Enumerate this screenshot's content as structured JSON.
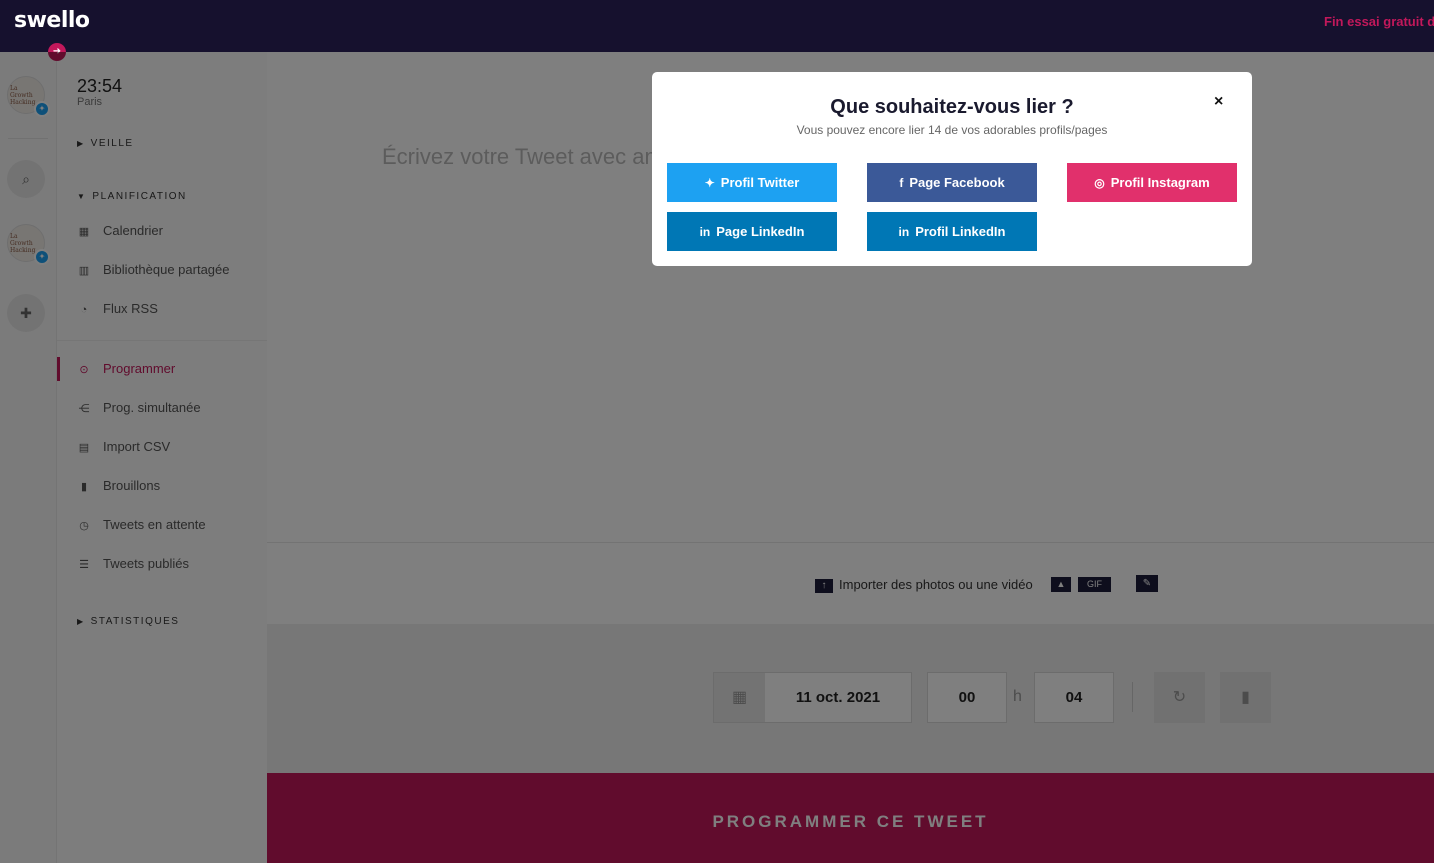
{
  "topbar": {
    "logo": "swello",
    "trial_text": "Fin essai gratuit da"
  },
  "sidebar": {
    "time": "23:54",
    "city": "Paris",
    "sections": {
      "veille": "VEILLE",
      "planification": "PLANIFICATION",
      "statistiques": "STATISTIQUES"
    },
    "items": [
      {
        "label": "Calendrier",
        "icon": "calendar-icon"
      },
      {
        "label": "Bibliothèque partagée",
        "icon": "library-icon"
      },
      {
        "label": "Flux RSS",
        "icon": "rss-icon"
      },
      {
        "label": "Programmer",
        "icon": "clock-icon",
        "active": true
      },
      {
        "label": "Prog. simultanée",
        "icon": "share-icon"
      },
      {
        "label": "Import CSV",
        "icon": "table-icon"
      },
      {
        "label": "Brouillons",
        "icon": "draft-icon"
      },
      {
        "label": "Tweets en attente",
        "icon": "history-icon"
      },
      {
        "label": "Tweets publiés",
        "icon": "list-icon"
      }
    ]
  },
  "rail": {
    "avatar_text": "La Growth Hacking"
  },
  "editor": {
    "placeholder": "Écrivez votre Tweet avec amour"
  },
  "media": {
    "upload_label": "Importer des photos ou une vidéo",
    "gif_label": "GIF"
  },
  "schedule": {
    "date": "11 oct. 2021",
    "hour": "00",
    "hour_sep": "h",
    "minute": "04"
  },
  "submit_label": "PROGRAMMER CE TWEET",
  "modal": {
    "title": "Que souhaitez-vous lier ?",
    "subtitle": "Vous pouvez encore lier 14 de vos adorables profils/pages",
    "close": "×",
    "buttons": {
      "twitter": "Profil Twitter",
      "facebook": "Page Facebook",
      "instagram": "Profil Instagram",
      "linkedin_page": "Page LinkedIn",
      "linkedin_profile": "Profil LinkedIn"
    }
  },
  "colors": {
    "brand": "#c2185b",
    "topbar": "#16112e",
    "twitter": "#1da1f2",
    "facebook": "#3b5998",
    "instagram": "#e1306c",
    "linkedin": "#0077b5"
  }
}
